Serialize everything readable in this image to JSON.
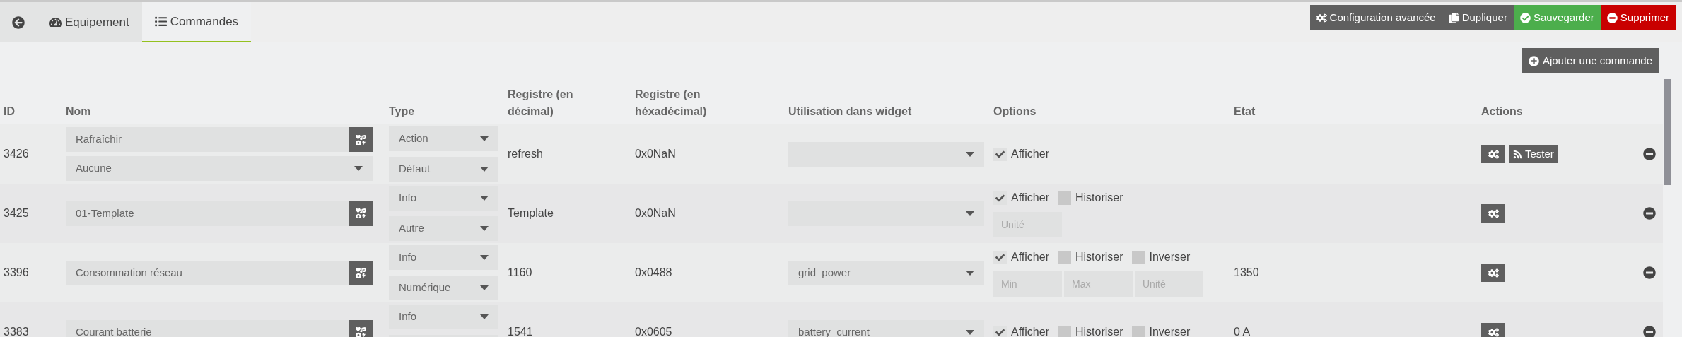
{
  "tabs": [
    {
      "label": "Equipement",
      "kind": "equipment",
      "selected": false
    },
    {
      "label": "Commandes",
      "kind": "commands",
      "selected": true
    }
  ],
  "toolbar": [
    {
      "label": "Configuration avancée",
      "kind": "config"
    },
    {
      "label": "Dupliquer",
      "kind": "duplicate"
    },
    {
      "label": "Sauvegarder",
      "kind": "save"
    },
    {
      "label": "Supprimer",
      "kind": "delete"
    }
  ],
  "add_button": "Ajouter une commande",
  "table": {
    "columns": [
      "ID",
      "Nom",
      "Type",
      "Registre (en décimal)",
      "Registre (en héxadécimal)",
      "Utilisation dans widget",
      "Options",
      "Etat",
      "Actions"
    ],
    "rows": [
      {
        "id": "3426",
        "name": "Rafraîchir",
        "generic_type": "Aucune",
        "type": "Action",
        "subtype": "Défaut",
        "register_dec": "refresh",
        "register_hex": "0x0NaN",
        "options": [
          {
            "label": "Afficher",
            "checked": true
          }
        ],
        "test": "Tester"
      },
      {
        "id": "3425",
        "name": "01-Template",
        "type": "Info",
        "subtype": "Autre",
        "register_dec": "Template",
        "register_hex": "0x0NaN",
        "options": [
          {
            "label": "Afficher",
            "checked": true
          },
          {
            "label": "Historiser",
            "checked": false
          }
        ],
        "inputs": [
          {
            "placeholder": "Unité"
          }
        ]
      },
      {
        "id": "3396",
        "name": "Consommation réseau",
        "type": "Info",
        "subtype": "Numérique",
        "register_dec": "1160",
        "register_hex": "0x0488",
        "widget": "grid_power",
        "options": [
          {
            "label": "Afficher",
            "checked": true
          },
          {
            "label": "Historiser",
            "checked": false
          },
          {
            "label": "Inverser",
            "checked": false
          }
        ],
        "inputs": [
          {
            "placeholder": "Min"
          },
          {
            "placeholder": "Max"
          },
          {
            "placeholder": "Unité"
          }
        ],
        "state": "1350"
      },
      {
        "id": "3383",
        "name": "Courant batterie",
        "type": "Info",
        "register_dec": "1541",
        "register_hex": "0x0605",
        "widget": "battery_current",
        "options": [
          {
            "label": "Afficher",
            "checked": true
          },
          {
            "label": "Historiser",
            "checked": false
          },
          {
            "label": "Inverser",
            "checked": false
          }
        ],
        "state": "0 A"
      }
    ]
  }
}
